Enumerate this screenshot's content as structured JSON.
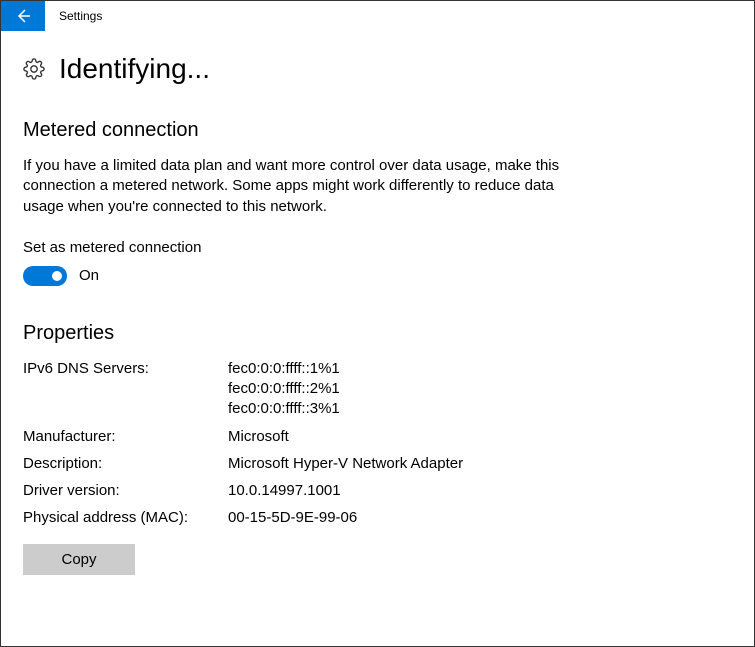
{
  "titlebar": {
    "app_name": "Settings"
  },
  "page": {
    "title": "Identifying..."
  },
  "metered": {
    "heading": "Metered connection",
    "description": "If you have a limited data plan and want more control over data usage, make this connection a metered network. Some apps might work differently to reduce data usage when you're connected to this network.",
    "toggle_label": "Set as metered connection",
    "toggle_state": "On",
    "toggle_on": true
  },
  "properties": {
    "heading": "Properties",
    "rows": [
      {
        "label": "IPv6 DNS Servers:",
        "value": "fec0:0:0:ffff::1%1\nfec0:0:0:ffff::2%1\nfec0:0:0:ffff::3%1"
      },
      {
        "label": "Manufacturer:",
        "value": "Microsoft"
      },
      {
        "label": "Description:",
        "value": "Microsoft Hyper-V Network Adapter"
      },
      {
        "label": "Driver version:",
        "value": "10.0.14997.1001"
      },
      {
        "label": "Physical address (MAC):",
        "value": "00-15-5D-9E-99-06"
      }
    ],
    "copy_label": "Copy"
  }
}
